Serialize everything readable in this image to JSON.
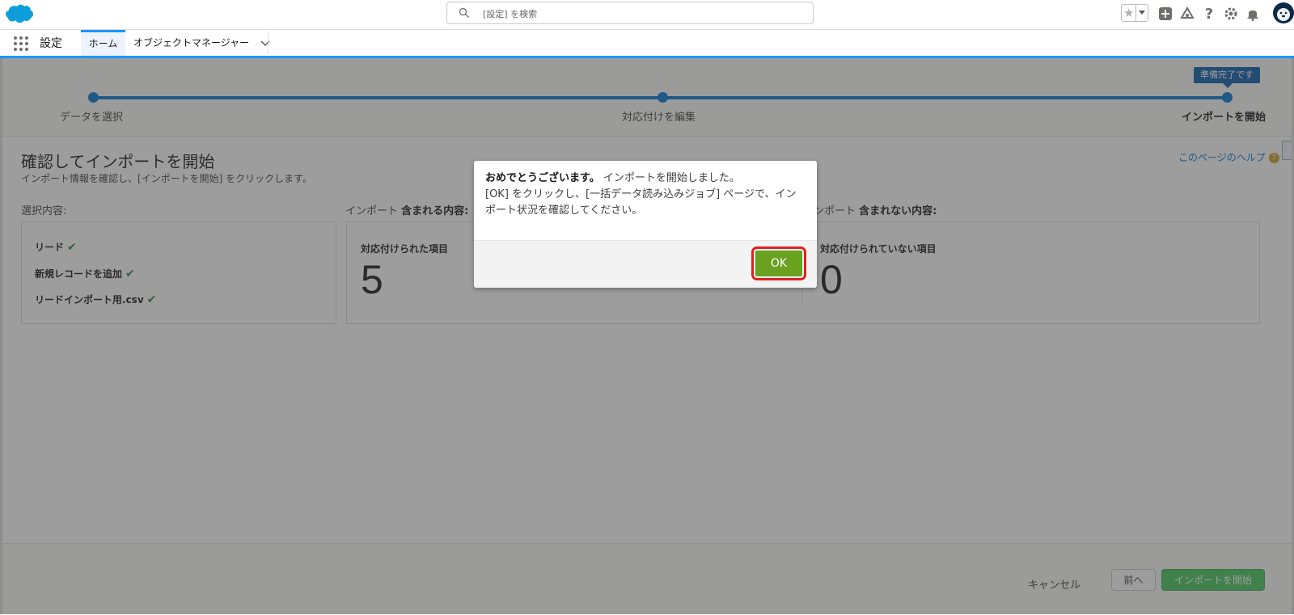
{
  "header": {
    "search_placeholder": "[設定] を検索",
    "icons": [
      "salesforce-cloud-logo",
      "search-icon",
      "star-icon",
      "add-icon",
      "trailhead-icon",
      "help-icon",
      "gear-icon",
      "bell-icon",
      "avatar"
    ]
  },
  "nav": {
    "app_name": "設定",
    "tabs": [
      {
        "label": "ホーム",
        "active": true
      },
      {
        "label": "オブジェクトマネージャー",
        "dropdown": true
      }
    ]
  },
  "progress": {
    "badge": "準備完了です",
    "steps": [
      {
        "label": "データを選択"
      },
      {
        "label": "対応付けを編集"
      },
      {
        "label": "インポートを開始",
        "current": true
      }
    ]
  },
  "page": {
    "title": "確認してインポートを開始",
    "subtitle": "インポート情報を確認し、[インポートを開始] をクリックします。",
    "help": "このページのヘルプ"
  },
  "selection": {
    "label": "選択内容:",
    "items": [
      "リード",
      "新規レコードを追加",
      "リードインポート用.csv"
    ]
  },
  "included": {
    "label_prefix": "インポート",
    "label_bold": "含まれる内容:",
    "mapped_label": "対応付けられた項目",
    "mapped_count": "5"
  },
  "excluded": {
    "label_prefix": "ンポート",
    "label_bold": "含まれない内容:",
    "unmapped_label": "対応付けられていない項目",
    "unmapped_count": "0"
  },
  "footer": {
    "cancel": "キャンセル",
    "prev": "前へ",
    "start": "インポートを開始"
  },
  "modal": {
    "title_bold": "おめでとうございます。",
    "title_rest": "インポートを開始しました。",
    "body": "[OK] をクリックし、[一括データ読み込みジョブ] ページで、インポート状況を確認してください。",
    "ok": "OK"
  },
  "colors": {
    "brand_blue": "#0176d3",
    "ok_green": "#6aa120",
    "highlight_red": "#e02020",
    "check_green": "#2e844a"
  }
}
